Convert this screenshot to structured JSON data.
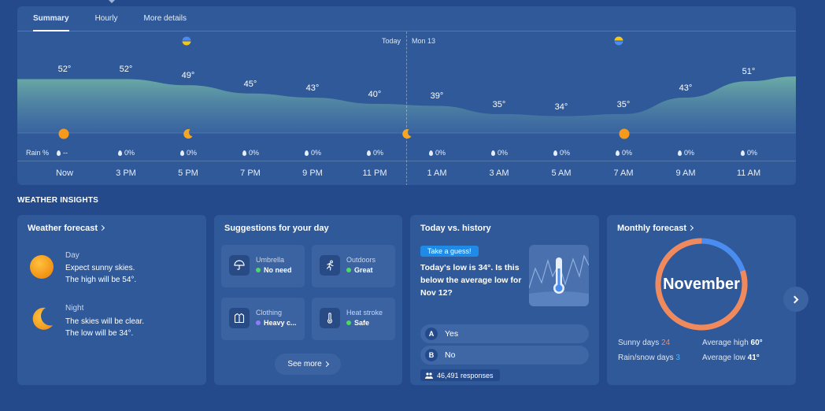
{
  "tabs": [
    {
      "label": "Summary",
      "active": true
    },
    {
      "label": "Hourly",
      "active": false
    },
    {
      "label": "More details",
      "active": false
    }
  ],
  "day_labels": {
    "today": "Today",
    "next": "Mon 13"
  },
  "hourly": [
    {
      "time": "Now",
      "temp": "52°",
      "rain": "--"
    },
    {
      "time": "3 PM",
      "temp": "52°",
      "rain": "0%"
    },
    {
      "time": "5 PM",
      "temp": "49°",
      "rain": "0%"
    },
    {
      "time": "7 PM",
      "temp": "45°",
      "rain": "0%"
    },
    {
      "time": "9 PM",
      "temp": "43°",
      "rain": "0%"
    },
    {
      "time": "11 PM",
      "temp": "40°",
      "rain": "0%"
    },
    {
      "time": "1 AM",
      "temp": "39°",
      "rain": "0%"
    },
    {
      "time": "3 AM",
      "temp": "35°",
      "rain": "0%"
    },
    {
      "time": "5 AM",
      "temp": "34°",
      "rain": "0%"
    },
    {
      "time": "7 AM",
      "temp": "35°",
      "rain": "0%"
    },
    {
      "time": "9 AM",
      "temp": "43°",
      "rain": "0%"
    },
    {
      "time": "11 AM",
      "temp": "51°",
      "rain": "0%"
    }
  ],
  "rain_title": "Rain %",
  "chart_colors": {
    "area_top": "#6fb0a6",
    "area_bottom": "#3f6ba6",
    "sun": "#f59a1b",
    "moon": "#f5a623"
  },
  "insights_heading": "WEATHER INSIGHTS",
  "forecast": {
    "title": "Weather forecast",
    "day": {
      "heading": "Day",
      "line1": "Expect sunny skies.",
      "line2": "The high will be 54°."
    },
    "night": {
      "heading": "Night",
      "line1": "The skies will be clear.",
      "line2": "The low will be 34°."
    }
  },
  "suggestions": {
    "title": "Suggestions for your day",
    "items": [
      {
        "name": "Umbrella",
        "status": "No need",
        "status_color": "#4cd964",
        "icon": "umbrella-icon"
      },
      {
        "name": "Outdoors",
        "status": "Great",
        "status_color": "#4cd964",
        "icon": "running-icon"
      },
      {
        "name": "Clothing",
        "status": "Heavy c...",
        "status_color": "#8f7cf7",
        "icon": "jacket-icon"
      },
      {
        "name": "Heat stroke",
        "status": "Safe",
        "status_color": "#4cd964",
        "icon": "thermometer-icon"
      }
    ],
    "see_more": "See more"
  },
  "history": {
    "title": "Today vs. history",
    "badge": "Take a guess!",
    "question": "Today's low is 34°. Is this below the average low for Nov 12?",
    "options": [
      {
        "letter": "A",
        "text": "Yes"
      },
      {
        "letter": "B",
        "text": "No"
      }
    ],
    "responses": "46,491 responses"
  },
  "monthly": {
    "title": "Monthly forecast",
    "month": "November",
    "sunny_label": "Sunny days",
    "sunny_value": "24",
    "rain_label": "Rain/snow days",
    "rain_value": "3",
    "high_label": "Average high",
    "high_value": "60°",
    "low_label": "Average low",
    "low_value": "41°",
    "sunny_fraction": 0.8,
    "colors": {
      "sunny": "#f08a5d",
      "rain": "#4a8cf0",
      "sunny_text": "#f08a5d",
      "rain_text": "#4fb3f5"
    }
  }
}
